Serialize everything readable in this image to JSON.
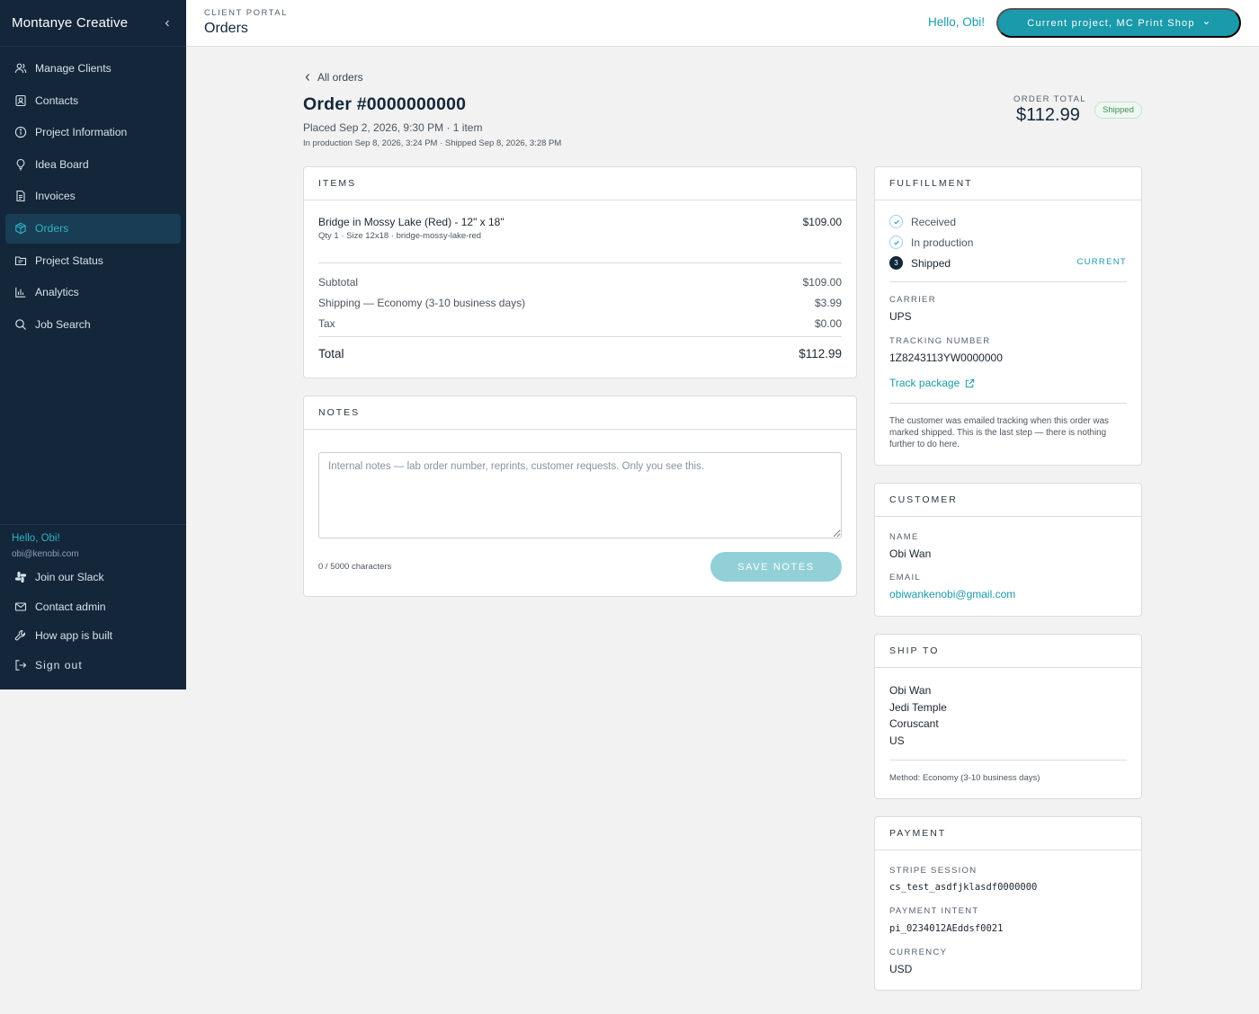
{
  "sidebar": {
    "brand": "Montanye Creative",
    "nav": [
      {
        "label": "Manage Clients",
        "icon": "users-icon"
      },
      {
        "label": "Contacts",
        "icon": "contact-card-icon"
      },
      {
        "label": "Project Information",
        "icon": "info-icon"
      },
      {
        "label": "Idea Board",
        "icon": "lightbulb-icon"
      },
      {
        "label": "Invoices",
        "icon": "document-icon"
      },
      {
        "label": "Orders",
        "icon": "package-icon",
        "active": true
      },
      {
        "label": "Project Status",
        "icon": "folder-icon"
      },
      {
        "label": "Analytics",
        "icon": "bar-chart-icon"
      },
      {
        "label": "Job Search",
        "icon": "search-icon"
      }
    ],
    "hello": "Hello, Obi!",
    "email": "obi@kenobi.com",
    "bottom": [
      {
        "label": "Join our Slack",
        "icon": "slack-icon"
      },
      {
        "label": "Contact admin",
        "icon": "mail-icon"
      },
      {
        "label": "How app is built",
        "icon": "wrench-icon"
      },
      {
        "label": "Sign out",
        "icon": "sign-out-icon"
      }
    ]
  },
  "topbar": {
    "kicker": "CLIENT PORTAL",
    "title": "Orders",
    "hello": "Hello, Obi!",
    "project_button": "Current project, MC Print Shop"
  },
  "order": {
    "back": "All orders",
    "title": "Order #0000000000",
    "placed": "Placed Sep 2, 2026, 9:30 PM · 1 item",
    "timeline": "In production Sep 8, 2026, 3:24 PM · Shipped Sep 8, 2026, 3:28 PM",
    "total_label": "ORDER TOTAL",
    "total_value": "$112.99",
    "status": "Shipped"
  },
  "items": {
    "heading": "ITEMS",
    "line": {
      "name": "Bridge in Mossy Lake (Red) - 12\" x 18\"",
      "meta": "Qty 1 · Size 12x18 · bridge-mossy-lake-red",
      "price": "$109.00"
    },
    "subtotal_label": "Subtotal",
    "subtotal": "$109.00",
    "shipping_label": "Shipping — Economy (3-10 business days)",
    "shipping": "$3.99",
    "tax_label": "Tax",
    "tax": "$0.00",
    "total_label": "Total",
    "total": "$112.99"
  },
  "notes": {
    "heading": "NOTES",
    "value": "",
    "placeholder": "Internal notes — lab order number, reprints, customer requests. Only you see this.",
    "count": "0 / 5000 characters",
    "save": "SAVE NOTES"
  },
  "fulfillment": {
    "heading": "FULFILLMENT",
    "steps": [
      "Received",
      "In production",
      "Shipped"
    ],
    "current_step_number": "3",
    "current_tag": "CURRENT",
    "carrier_label": "CARRIER",
    "carrier": "UPS",
    "tracking_label": "TRACKING NUMBER",
    "tracking": "1Z8243113YW0000000",
    "track_link": "Track package",
    "note": "The customer was emailed tracking when this order was marked shipped. This is the last step — there is nothing further to do here."
  },
  "customer": {
    "heading": "CUSTOMER",
    "name_label": "NAME",
    "name": "Obi Wan",
    "email_label": "EMAIL",
    "email": "obiwankenobi@gmail.com"
  },
  "ship_to": {
    "heading": "SHIP TO",
    "lines": [
      "Obi Wan",
      "Jedi Temple",
      "Coruscant",
      "US"
    ],
    "method": "Method: Economy (3-10 business days)"
  },
  "payment": {
    "heading": "PAYMENT",
    "session_label": "STRIPE SESSION",
    "session": "cs_test_asdfjklasdf0000000",
    "intent_label": "PAYMENT INTENT",
    "intent": "pi_0234012AEddsf0021",
    "currency_label": "CURRENCY",
    "currency": "USD"
  },
  "colors": {
    "sidebar": "#13263a",
    "accent": "#1a9aab",
    "active_bg": "#183d55",
    "success": "#3f8c55"
  }
}
